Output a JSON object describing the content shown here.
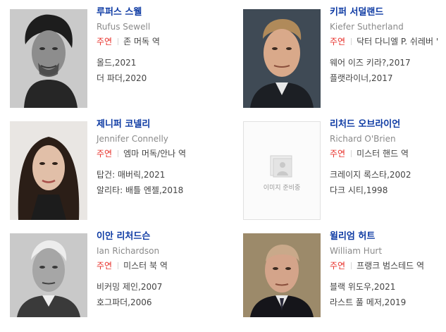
{
  "placeholder_text": "이미지 준비중",
  "cast": [
    {
      "name": "루퍼스 스웰",
      "english_name": "Rufus Sewell",
      "role_tag": "주연",
      "role": "존 머독 역",
      "works": [
        "올드,2021",
        "더 파더,2020"
      ]
    },
    {
      "name": "키퍼 서덜랜드",
      "english_name": "Kiefer Sutherland",
      "role_tag": "주연",
      "role": "닥터 다니엘 P. 쉬레버 '",
      "works": [
        "웨어 이즈 키라?,2017",
        "플랫라이너,2017"
      ]
    },
    {
      "name": "제니퍼 코넬리",
      "english_name": "Jennifer Connelly",
      "role_tag": "주연",
      "role": "엠마 머독/안나 역",
      "works": [
        "탑건: 매버릭,2021",
        "알리타: 배틀 엔젤,2018"
      ]
    },
    {
      "name": "리처드 오브라이언",
      "english_name": "Richard O'Brien",
      "role_tag": "주연",
      "role": "미스터 핸드 역",
      "works": [
        "크레이지 록스타,2002",
        "다크 시티,1998"
      ]
    },
    {
      "name": "이안 리처드슨",
      "english_name": "Ian Richardson",
      "role_tag": "주연",
      "role": "미스터 북 역",
      "works": [
        "비커밍 제인,2007",
        "호그파더,2006"
      ]
    },
    {
      "name": "윌리엄 허트",
      "english_name": "William Hurt",
      "role_tag": "주연",
      "role": "프랭크 범스테드 역",
      "works": [
        "블랙 위도우,2021",
        "라스트 풀 메저,2019"
      ]
    }
  ]
}
